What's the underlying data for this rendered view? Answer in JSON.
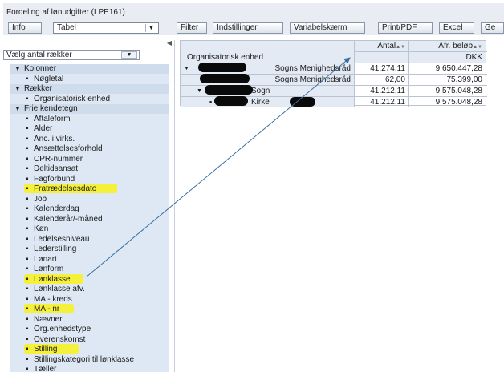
{
  "app": {
    "title": "Fordeling af lønudgifter (LPE161)"
  },
  "toolbar": {
    "info": "Info",
    "view_select": "Tabel",
    "filter": "Filter",
    "settings": "Indstillinger",
    "variable_screen": "Variabelskærm",
    "print": "Print/PDF",
    "excel": "Excel",
    "cut_off": "Ge"
  },
  "left_panel": {
    "rows_select": "Vælg antal rækker",
    "groups": {
      "kolonner": "Kolonner",
      "raekker": "Rækker",
      "frie": "Frie kendetegn"
    },
    "kolonner_items": [
      "Nøgletal"
    ],
    "raekker_items": [
      "Organisatorisk enhed"
    ],
    "frie_items": [
      "Aftaleform",
      "Alder",
      "Anc. i virks.",
      "Ansættelsesforhold",
      "CPR-nummer",
      "Deltidsansat",
      "Fagforbund",
      "Fratrædelsesdato",
      "Job",
      "Kalenderdag",
      "Kalenderår/-måned",
      "Køn",
      "Ledelsesniveau",
      "Lederstilling",
      "Lønart",
      "Lønform",
      "Lønklasse",
      "Lønklasse afv.",
      "MA - kreds",
      "MA - nr",
      "Nævner",
      "Org.enhedstype",
      "Overenskomst",
      "Stilling",
      "Stillingskategori til lønklasse",
      "Tæller"
    ],
    "highlighted": [
      "Fratrædelsesdato",
      "Lønklasse",
      "MA - nr",
      "Stilling"
    ]
  },
  "pivot": {
    "col_headers": [
      "Antal",
      "Afr. beløb"
    ],
    "sort_marks": "▲▼",
    "unit": "DKK",
    "row_header": "Organisatorisk enhed",
    "rows": [
      {
        "label": "Sogns Menighedsråd",
        "antal": "41.274,11",
        "belob": "9.650.447,28"
      },
      {
        "label": "Sogns Menighedsråd",
        "antal": "62,00",
        "belob": "75.399,00"
      },
      {
        "label": "Sogn",
        "antal": "41.212,11",
        "belob": "9.575.048,28"
      },
      {
        "label": "Kirke",
        "antal": "41.212,11",
        "belob": "9.575.048,28"
      }
    ]
  },
  "colors": {
    "highlight": "#f5f03a",
    "tree_bg": "#dde8f4",
    "arrow": "#3a6fa0"
  }
}
